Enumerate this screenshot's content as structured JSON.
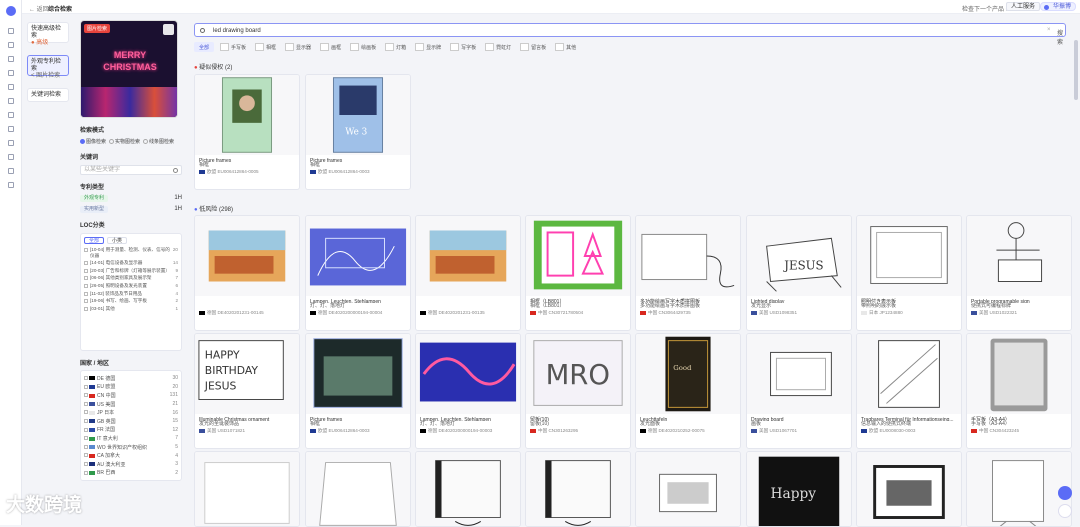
{
  "topbar": {
    "back": "← 返回",
    "title": "综合检索",
    "help": "检查下一个产品 ›",
    "service": "人工服务",
    "user": "华振博"
  },
  "modes": [
    {
      "label": "快速高级检索",
      "sub": "● 高级",
      "on": false
    },
    {
      "label": "外观专利检索",
      "sub": "< 图片检索",
      "on": true
    },
    {
      "label": "关键词检索",
      "sub": "",
      "on": false
    }
  ],
  "preview": {
    "tag": "图片检索",
    "text": "MERRY CHRISTMAS"
  },
  "search_mode": {
    "label": "检索模式",
    "options": [
      "图像检索",
      "实物图检索",
      "线条图检索"
    ]
  },
  "keyword": {
    "label": "关键词",
    "placeholder": "以某些关键字"
  },
  "patent_type": {
    "label": "专利类型",
    "items": [
      {
        "name": "外观专利",
        "count": "1H"
      },
      {
        "name": "实用新型",
        "count": "1H"
      }
    ]
  },
  "locarno": {
    "label": "LOC分类",
    "tabs": [
      "全部",
      "小类"
    ],
    "rows": [
      {
        "text": "[10-04] 用于测量、检测、仪表、信号的仪器",
        "count": "20"
      },
      {
        "text": "[14-01] 电信设备及显示器",
        "count": "14"
      },
      {
        "text": "[20-03] 广告和标牌（灯箱等展示装置）",
        "count": "9"
      },
      {
        "text": "[06-06] 其他类别家具及展示架",
        "count": "7"
      },
      {
        "text": "[26-05] 照明设备及发光装置",
        "count": "6"
      },
      {
        "text": "[11-02] 装饰品及节日用品",
        "count": "4"
      },
      {
        "text": "[19-06] 书写、绘画、写字板",
        "count": "2"
      },
      {
        "text": "[03-01] 其他",
        "count": "1"
      }
    ]
  },
  "countries": {
    "label": "国家 / 地区",
    "rows": [
      {
        "name": "DE 德国",
        "count": "30",
        "color": "#000000"
      },
      {
        "name": "EU 欧盟",
        "count": "20",
        "color": "#1f3a93"
      },
      {
        "name": "CN 中国",
        "count": "131",
        "color": "#d8281f"
      },
      {
        "name": "US 美国",
        "count": "21",
        "color": "#3a4f9c"
      },
      {
        "name": "JP 日本",
        "count": "16",
        "color": "#e8e8e8"
      },
      {
        "name": "GB 英国",
        "count": "15",
        "color": "#203a88"
      },
      {
        "name": "FR 法国",
        "count": "12",
        "color": "#2a4aa8"
      },
      {
        "name": "IT 意大利",
        "count": "7",
        "color": "#2f9a4c"
      },
      {
        "name": "WO 世界知识产权组织",
        "count": "5",
        "color": "#5a8ad0"
      },
      {
        "name": "CA 加拿大",
        "count": "4",
        "color": "#d8281f"
      },
      {
        "name": "AU 澳大利亚",
        "count": "3",
        "color": "#1b2f7a"
      },
      {
        "name": "BR 巴西",
        "count": "2",
        "color": "#2f9a4c"
      }
    ]
  },
  "search": {
    "query": "led drawing board",
    "clear": "×",
    "button": "搜索"
  },
  "filters": [
    "全部",
    "手写板",
    "相框",
    "显示器",
    "画框",
    "绘画板",
    "灯箱",
    "显示牌",
    "写字板",
    "霓虹灯",
    "留言板",
    "其他"
  ],
  "section1": {
    "title": "疑似侵权",
    "count": "(2)"
  },
  "section2": {
    "title": "低风险",
    "count": "(298)"
  },
  "cards_row1": [
    {
      "t1": "Picture frames",
      "t2": "相框",
      "meta": "欧盟  EU006412864-0005",
      "flag": "#1f3a93",
      "kind": "frame-photo"
    },
    {
      "t1": "Picture frames",
      "t2": "相框",
      "meta": "欧盟  EU006412864-0003",
      "flag": "#1f3a93",
      "kind": "frame-night"
    }
  ],
  "cards_row2": [
    {
      "t1": "",
      "t2": "",
      "meta": "德国  DE4020201231-00145",
      "flag": "#000000",
      "kind": "painting"
    },
    {
      "t1": "Lampen, Leuchten, Stehlampen",
      "t2": "灯、灯、落地灯",
      "meta": "德国  DE4020200000194-00004",
      "flag": "#000000",
      "kind": "neon-sign"
    },
    {
      "t1": "",
      "t2": "",
      "meta": "德国  DE4020201231-00135",
      "flag": "#000000",
      "kind": "painting"
    },
    {
      "t1": "相框（LB801）",
      "t2": "相框（LB801）",
      "meta": "中国  CN30721780504",
      "flag": "#d8281f",
      "kind": "green-frame"
    },
    {
      "t1": "多功能绘画写字木质拼图板",
      "t2": "多功能绘画写字木质拼图板",
      "meta": "中国  CN3064429735",
      "flag": "#d8281f",
      "kind": "tablet-cable"
    },
    {
      "t1": "Lighted display",
      "t2": "发光显示",
      "meta": "美国  USD1098351",
      "flag": "#3a4f9c",
      "kind": "jesus-sign"
    },
    {
      "t1": "照明付き表示板",
      "t2": "带照明的展示板",
      "meta": "日本  JP1234880",
      "flag": "#e8e8e8",
      "kind": "board-outline"
    },
    {
      "t1": "Portable programable sign",
      "t2": "便携式可编程标牌",
      "meta": "美国  USD1022321",
      "flag": "#3a4f9c",
      "kind": "person-sign"
    }
  ],
  "cards_row3": [
    {
      "t1": "Illuminable Christmas ornament",
      "t2": "发光的圣诞装饰品",
      "meta": "美国  USD1071821",
      "flag": "#3a4f9c",
      "kind": "birthday"
    },
    {
      "t1": "Picture frames",
      "t2": "相框",
      "meta": "欧盟  EU006412864-0003",
      "flag": "#1f3a93",
      "kind": "frame-dark"
    },
    {
      "t1": "Lampen, Leuchten, Stehlampen",
      "t2": "灯、灯、落地灯",
      "meta": "德国  DE4020200000194-00003",
      "flag": "#000000",
      "kind": "neon-wave"
    },
    {
      "t1": "留板(10)",
      "t2": "留板(10)",
      "meta": "中国  CN301263295",
      "flag": "#d8281f",
      "kind": "pattern"
    },
    {
      "t1": "Leuchttafeln",
      "t2": "发光面板",
      "meta": "德国  DE4020210252-00075",
      "flag": "#000000",
      "kind": "chalk"
    },
    {
      "t1": "Drawing board",
      "t2": "画板",
      "meta": "美国  USD1067701",
      "flag": "#3a4f9c",
      "kind": "drawing-board"
    },
    {
      "t1": "Tragbares Terminal für Informationseing...",
      "t2": "信息输入的便携式终端",
      "meta": "欧盟  EU0008030-0003",
      "flag": "#1f3a93",
      "kind": "hatched-box"
    },
    {
      "t1": "手写板（A3-A4）",
      "t2": "手写板（A3-A4）",
      "meta": "中国  CN304423245",
      "flag": "#d8281f",
      "kind": "tablet-gray"
    }
  ],
  "cards_row4": [
    {
      "kind": "plain-doc"
    },
    {
      "kind": "glass-sheet"
    },
    {
      "kind": "light-pad"
    },
    {
      "kind": "light-pad"
    },
    {
      "kind": "machine"
    },
    {
      "kind": "happy-neon"
    },
    {
      "kind": "machine-framed"
    },
    {
      "kind": "sketch-stand"
    }
  ],
  "colors": {
    "accent": "#5b6cf6",
    "danger": "#e7443d"
  },
  "watermark": "大数跨境"
}
